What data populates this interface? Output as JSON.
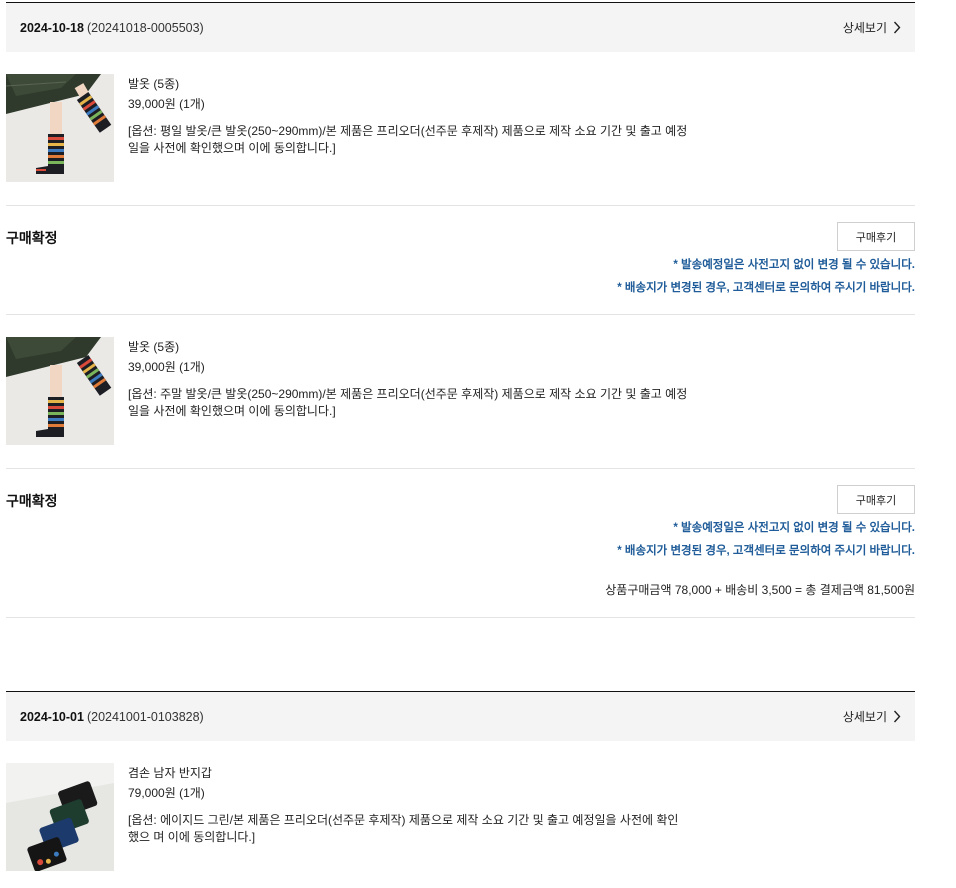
{
  "orders": [
    {
      "date": "2024-10-18",
      "order_no": "(20241018-0005503)",
      "detail_label": "상세보기",
      "items": [
        {
          "name": "발옷 (5종)",
          "price": "39,000원 (1개)",
          "option": "[옵션: 평일 발옷/큰 발옷(250~290mm)/본 제품은 프리오더(선주문 후제작) 제품으로 제작 소요 기간 및 출고 예정 일을 사전에 확인했으며 이에 동의합니다.]",
          "status": "구매확정",
          "review_label": "구매후기",
          "notice1": "* 발송예정일은 사전고지 없이 변경 될 수 있습니다.",
          "notice2": "* 배송지가 변경된 경우, 고객센터로 문의하여 주시기 바랍니다."
        },
        {
          "name": "발옷 (5종)",
          "price": "39,000원 (1개)",
          "option": "[옵션: 주말 발옷/큰 발옷(250~290mm)/본 제품은 프리오더(선주문 후제작) 제품으로 제작 소요 기간 및 출고 예정 일을 사전에 확인했으며 이에 동의합니다.]",
          "status": "구매확정",
          "review_label": "구매후기",
          "notice1": "* 발송예정일은 사전고지 없이 변경 될 수 있습니다.",
          "notice2": "* 배송지가 변경된 경우, 고객센터로 문의하여 주시기 바랍니다."
        }
      ],
      "total_text": "상품구매금액 78,000 + 배송비 3,500 =  총 결제금액 81,500원"
    },
    {
      "date": "2024-10-01",
      "order_no": "(20241001-0103828)",
      "detail_label": "상세보기",
      "items": [
        {
          "name": "겸손 남자 반지갑",
          "price": "79,000원 (1개)",
          "option": "[옵션: 에이지드 그린/본 제품은 프리오더(선주문 후제작) 제품으로 제작 소요 기간 및 출고 예정일을 사전에 확인했으 며 이에 동의합니다.]"
        }
      ]
    }
  ]
}
